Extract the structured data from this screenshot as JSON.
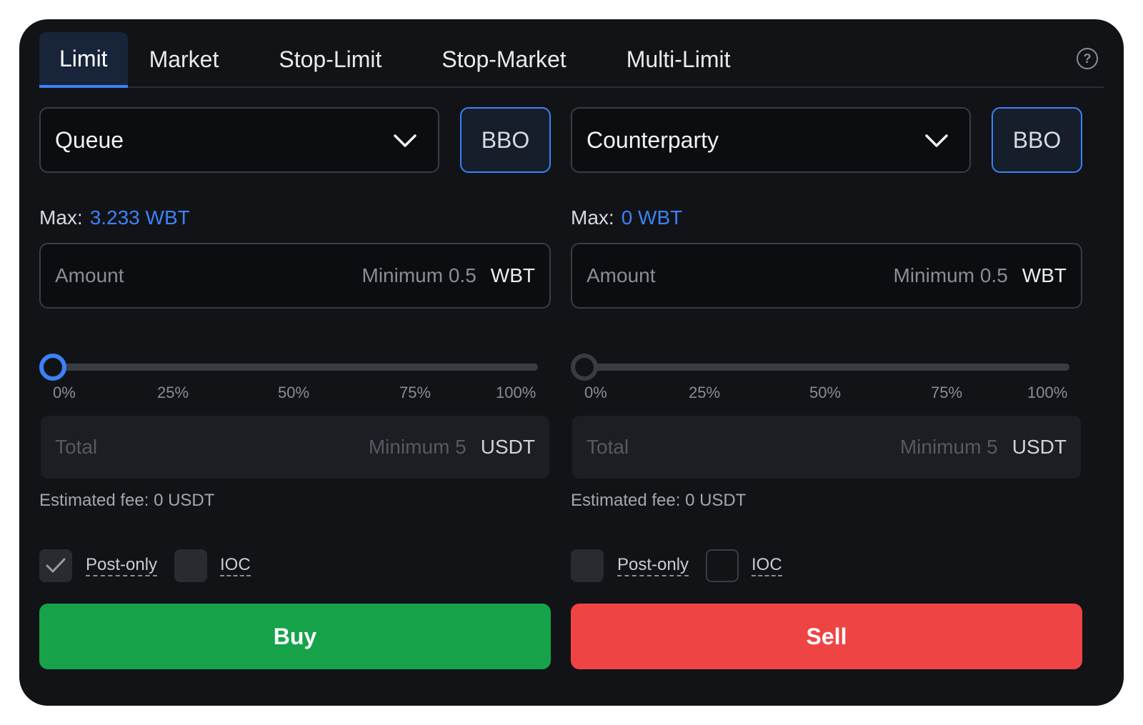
{
  "tabs": [
    {
      "label": "Limit",
      "active": true
    },
    {
      "label": "Market",
      "active": false
    },
    {
      "label": "Stop-Limit",
      "active": false
    },
    {
      "label": "Stop-Market",
      "active": false
    },
    {
      "label": "Multi-Limit",
      "active": false
    }
  ],
  "help_glyph": "?",
  "colors": {
    "accent": "#3b82f6",
    "buy": "#16a34a",
    "sell": "#ef4444",
    "panel": "#121317"
  },
  "buy_side": {
    "order_type": "Queue",
    "bbo_label": "BBO",
    "max_label": "Max:",
    "max_value": "3.233 WBT",
    "amount": {
      "placeholder": "Amount",
      "minimum": "Minimum 0.5",
      "unit": "WBT"
    },
    "slider_percent": 0,
    "ticks": [
      "0%",
      "25%",
      "50%",
      "75%",
      "100%"
    ],
    "total": {
      "placeholder": "Total",
      "minimum": "Minimum 5",
      "unit": "USDT"
    },
    "fee": "Estimated fee: 0 USDT",
    "post_only": {
      "label": "Post-only",
      "checked": true
    },
    "ioc": {
      "label": "IOC",
      "checked": false
    },
    "action_label": "Buy"
  },
  "sell_side": {
    "order_type": "Counterparty",
    "bbo_label": "BBO",
    "max_label": "Max:",
    "max_value": "0 WBT",
    "amount": {
      "placeholder": "Amount",
      "minimum": "Minimum 0.5",
      "unit": "WBT"
    },
    "slider_percent": 0,
    "ticks": [
      "0%",
      "25%",
      "50%",
      "75%",
      "100%"
    ],
    "total": {
      "placeholder": "Total",
      "minimum": "Minimum 5",
      "unit": "USDT"
    },
    "fee": "Estimated fee: 0 USDT",
    "post_only": {
      "label": "Post-only",
      "checked": false
    },
    "ioc": {
      "label": "IOC",
      "checked": false
    },
    "action_label": "Sell"
  }
}
